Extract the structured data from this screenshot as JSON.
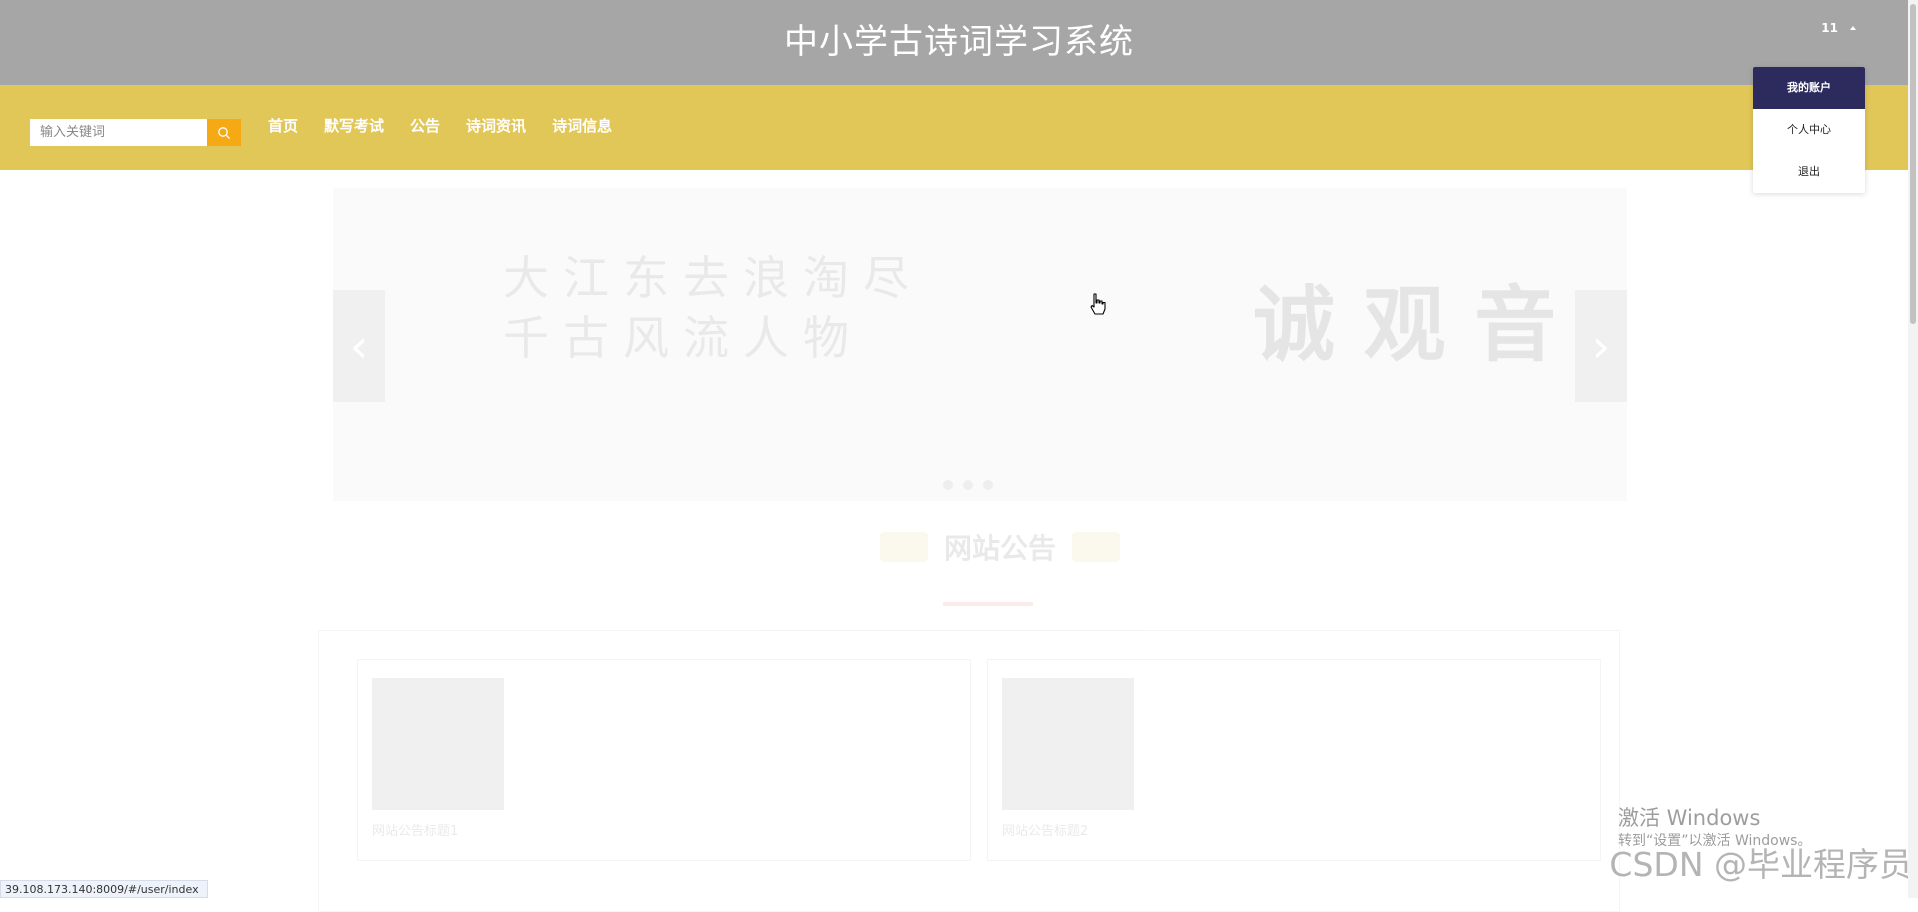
{
  "header": {
    "title": "中小学古诗词学习系统",
    "username": "11"
  },
  "search": {
    "placeholder": "输入关键词",
    "value": ""
  },
  "nav": {
    "items": [
      {
        "label": "首页"
      },
      {
        "label": "默写考试"
      },
      {
        "label": "公告"
      },
      {
        "label": "诗词资讯"
      },
      {
        "label": "诗词信息"
      }
    ]
  },
  "user_menu": {
    "items": [
      {
        "label": "我的账户"
      },
      {
        "label": "个人中心"
      },
      {
        "label": "退出"
      }
    ]
  },
  "carousel": {
    "calligraphy_lines": [
      "大江东去浪淘尽",
      "千古风流人物"
    ],
    "title": "诚 观 音"
  },
  "notice": {
    "title": "网站公告",
    "cards": [
      {
        "title": "网站公告标题1"
      },
      {
        "title": "网站公告标题2"
      }
    ]
  },
  "status_bar": {
    "url": "39.108.173.140:8009/#/user/index"
  },
  "windows_activation": {
    "title": "激活 Windows",
    "subtitle": "转到“设置”以激活 Windows。"
  },
  "watermark": "CSDN @毕业程序员",
  "colors": {
    "header_bg": "#a6a6a6",
    "nav_bg": "#e1c758",
    "search_button": "#f4a915",
    "menu_active": "#2d2b5e"
  },
  "icons": {
    "search": "search-icon",
    "caret": "caret-up-icon",
    "cursor": "hand-cursor-icon"
  }
}
